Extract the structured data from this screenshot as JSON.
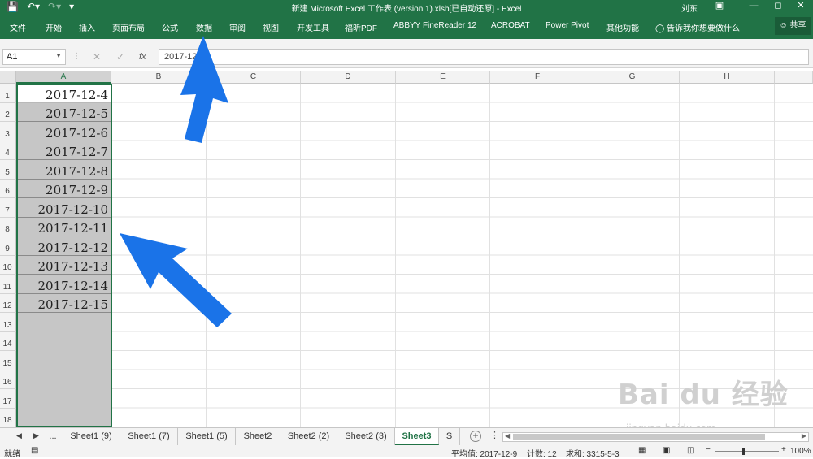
{
  "title_bar": {
    "title": "新建 Microsoft Excel 工作表 (version 1).xlsb[已自动还原]  -  Excel",
    "user": "刘东"
  },
  "ribbon": {
    "tabs": [
      "文件",
      "开始",
      "插入",
      "页面布局",
      "公式",
      "数据",
      "审阅",
      "视图",
      "开发工具",
      "福昕PDF",
      "ABBYY FineReader 12",
      "ACROBAT",
      "Power Pivot",
      "其他功能"
    ],
    "tell_me": "告诉我你想要做什么",
    "share": "共享"
  },
  "formula_bar": {
    "name_box": "A1",
    "fx": "fx",
    "content": "2017-12-4"
  },
  "columns": [
    "A",
    "B",
    "C",
    "D",
    "E",
    "F",
    "G",
    "H"
  ],
  "rows": [
    "1",
    "2",
    "3",
    "4",
    "5",
    "6",
    "7",
    "8",
    "9",
    "10",
    "11",
    "12",
    "13",
    "14",
    "15",
    "16",
    "17",
    "18"
  ],
  "column_a_values": [
    "2017-12-4",
    "2017-12-5",
    "2017-12-6",
    "2017-12-7",
    "2017-12-8",
    "2017-12-9",
    "2017-12-10",
    "2017-12-11",
    "2017-12-12",
    "2017-12-13",
    "2017-12-14",
    "2017-12-15"
  ],
  "sheet_tabs": [
    "...",
    "Sheet1 (9)",
    "Sheet1 (7)",
    "Sheet1 (5)",
    "Sheet2",
    "Sheet2 (2)",
    "Sheet2 (3)",
    "Sheet3",
    "S"
  ],
  "active_sheet": "Sheet3",
  "status_bar": {
    "ready": "就绪",
    "average": "平均值: 2017-12-9",
    "count": "计数: 12",
    "sum": "求和: 3315-5-3",
    "zoom": "100%"
  },
  "watermark": {
    "brand": "Bai du 经验",
    "url": "jingyan.baidu.com"
  },
  "colors": {
    "excel_green": "#217346",
    "arrow_blue": "#1a73e8",
    "selection_gray": "#c6c6c6"
  }
}
